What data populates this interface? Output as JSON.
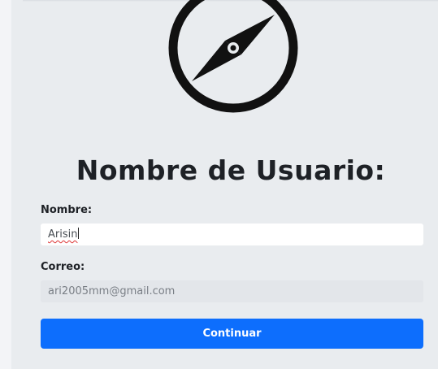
{
  "form": {
    "title": "Nombre de Usuario:",
    "name_label": "Nombre:",
    "name_value": "Arisin",
    "email_label": "Correo:",
    "email_value": "ari2005mm@gmail.com",
    "submit_label": "Continuar"
  },
  "colors": {
    "page_bg": "#e9ecef",
    "button_bg": "#0d6efd",
    "button_text": "#ffffff",
    "disabled_input_bg": "#e3e6ea"
  },
  "icons": {
    "logo": "compass-icon"
  }
}
